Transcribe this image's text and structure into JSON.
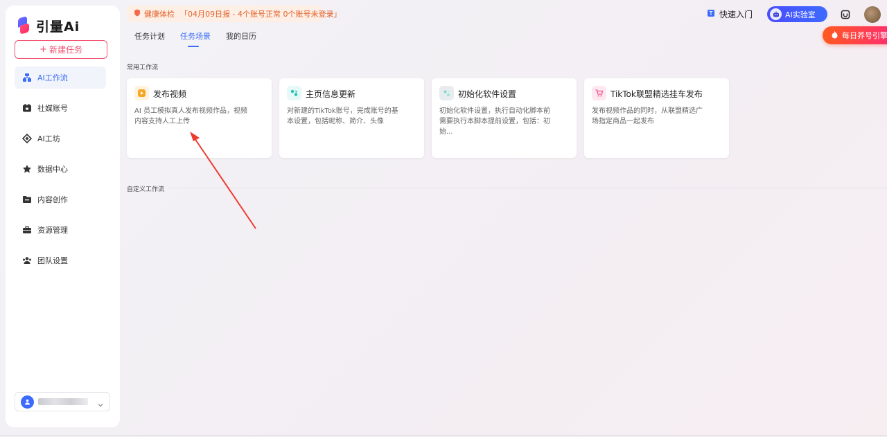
{
  "brand": {
    "name": "引量Ai"
  },
  "sidebar": {
    "new_task_label": "新建任务",
    "items": [
      {
        "label": "AI工作流",
        "icon": "workflow-icon",
        "active": true
      },
      {
        "label": "社媒账号",
        "icon": "calendar-icon",
        "active": false
      },
      {
        "label": "AI工坊",
        "icon": "ai-workshop-icon",
        "active": false
      },
      {
        "label": "数据中心",
        "icon": "data-center-icon",
        "active": false
      },
      {
        "label": "内容创作",
        "icon": "folder-icon",
        "active": false
      },
      {
        "label": "资源管理",
        "icon": "briefcase-icon",
        "active": false
      },
      {
        "label": "团队设置",
        "icon": "team-icon",
        "active": false
      }
    ]
  },
  "header": {
    "health_label": "健康体检",
    "health_report": "「04月09日报 - 4个账号正常 0个账号未登录」",
    "tabs": [
      {
        "label": "任务计划",
        "active": false
      },
      {
        "label": "任务场景",
        "active": true
      },
      {
        "label": "我的日历",
        "active": false
      }
    ],
    "quick_start": "快速入门",
    "ai_lab": "AI实验室",
    "daily_promo": "每日养号引擎"
  },
  "main": {
    "common_section": "常用工作流",
    "custom_section": "自定义工作流",
    "cards": [
      {
        "title": "发布视频",
        "desc": "AI 员工模拟真人发布视频作品，视频内容支持人工上传",
        "icon": "play-icon",
        "color": "#f5a623"
      },
      {
        "title": "主页信息更新",
        "desc": "对新建的TikTok账号，完成账号的基本设置，包括昵称、简介、头像",
        "icon": "update-icon",
        "color": "#1fc3b4"
      },
      {
        "title": "初始化软件设置",
        "desc": "初始化软件设置，执行自动化脚本前需要执行本脚本提前设置，包括：初始...",
        "icon": "settings-icon",
        "color": "#4ecdc4"
      },
      {
        "title": "TikTok联盟精选挂车发布",
        "desc": "发布视频作品的同时，从联盟精选广场指定商品一起发布",
        "icon": "cart-icon",
        "color": "#f2508c"
      }
    ]
  },
  "colors": {
    "accent": "#3b6cf6",
    "brand_red": "#f2506e",
    "warning": "#e2612a"
  }
}
